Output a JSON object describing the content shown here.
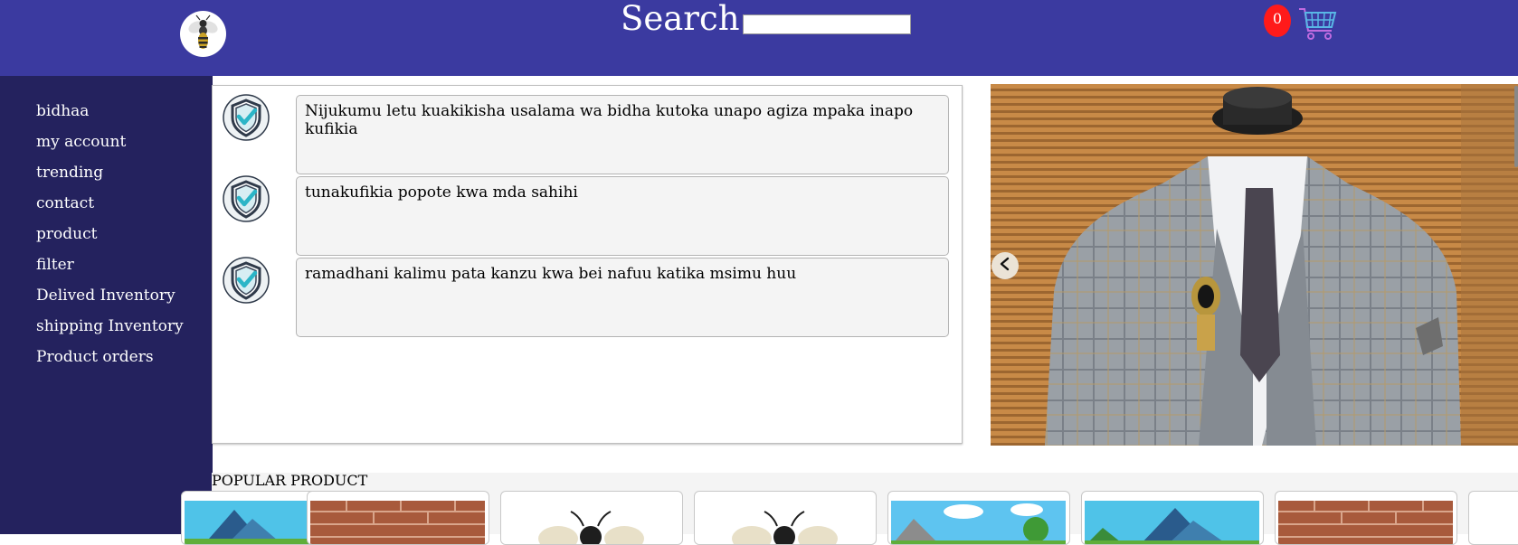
{
  "header": {
    "search_label": "Search",
    "search_value": "",
    "cart_count": "0",
    "colors": {
      "header_bg": "#3b3aa0",
      "badge": "#ff1a1a"
    },
    "logo_icon": "wasp-logo-icon",
    "cart_icon": "shopping-cart-icon"
  },
  "sidebar": {
    "items": [
      {
        "label": "bidhaa"
      },
      {
        "label": "my account"
      },
      {
        "label": "trending"
      },
      {
        "label": "contact"
      },
      {
        "label": "product"
      },
      {
        "label": "filter"
      },
      {
        "label": "Delived Inventory"
      },
      {
        "label": "shipping Inventory"
      },
      {
        "label": "Product orders"
      }
    ]
  },
  "features": [
    {
      "icon": "shield-check-icon",
      "text": "Nijukumu letu kuakikisha usalama wa bidha kutoka unapo agiza mpaka inapo kufikia"
    },
    {
      "icon": "shield-check-icon",
      "text": "tunakufikia popote kwa mda sahihi"
    },
    {
      "icon": "shield-check-icon",
      "text": "ramadhani kalimu pata kanzu kwa bei nafuu katika msimu huu"
    }
  ],
  "hero": {
    "image": "suit-on-mannequin",
    "prev_icon": "chevron-left-icon"
  },
  "popular": {
    "title": "POPULAR PRODUCT",
    "products": [
      {
        "image": "mountain-scene"
      },
      {
        "image": "brick-wall"
      },
      {
        "image": "wasp"
      },
      {
        "image": "wasp"
      },
      {
        "image": "cartoon-landscape"
      },
      {
        "image": "mountain-scene"
      },
      {
        "image": "brick-wall"
      },
      {
        "image": "blank"
      }
    ]
  }
}
